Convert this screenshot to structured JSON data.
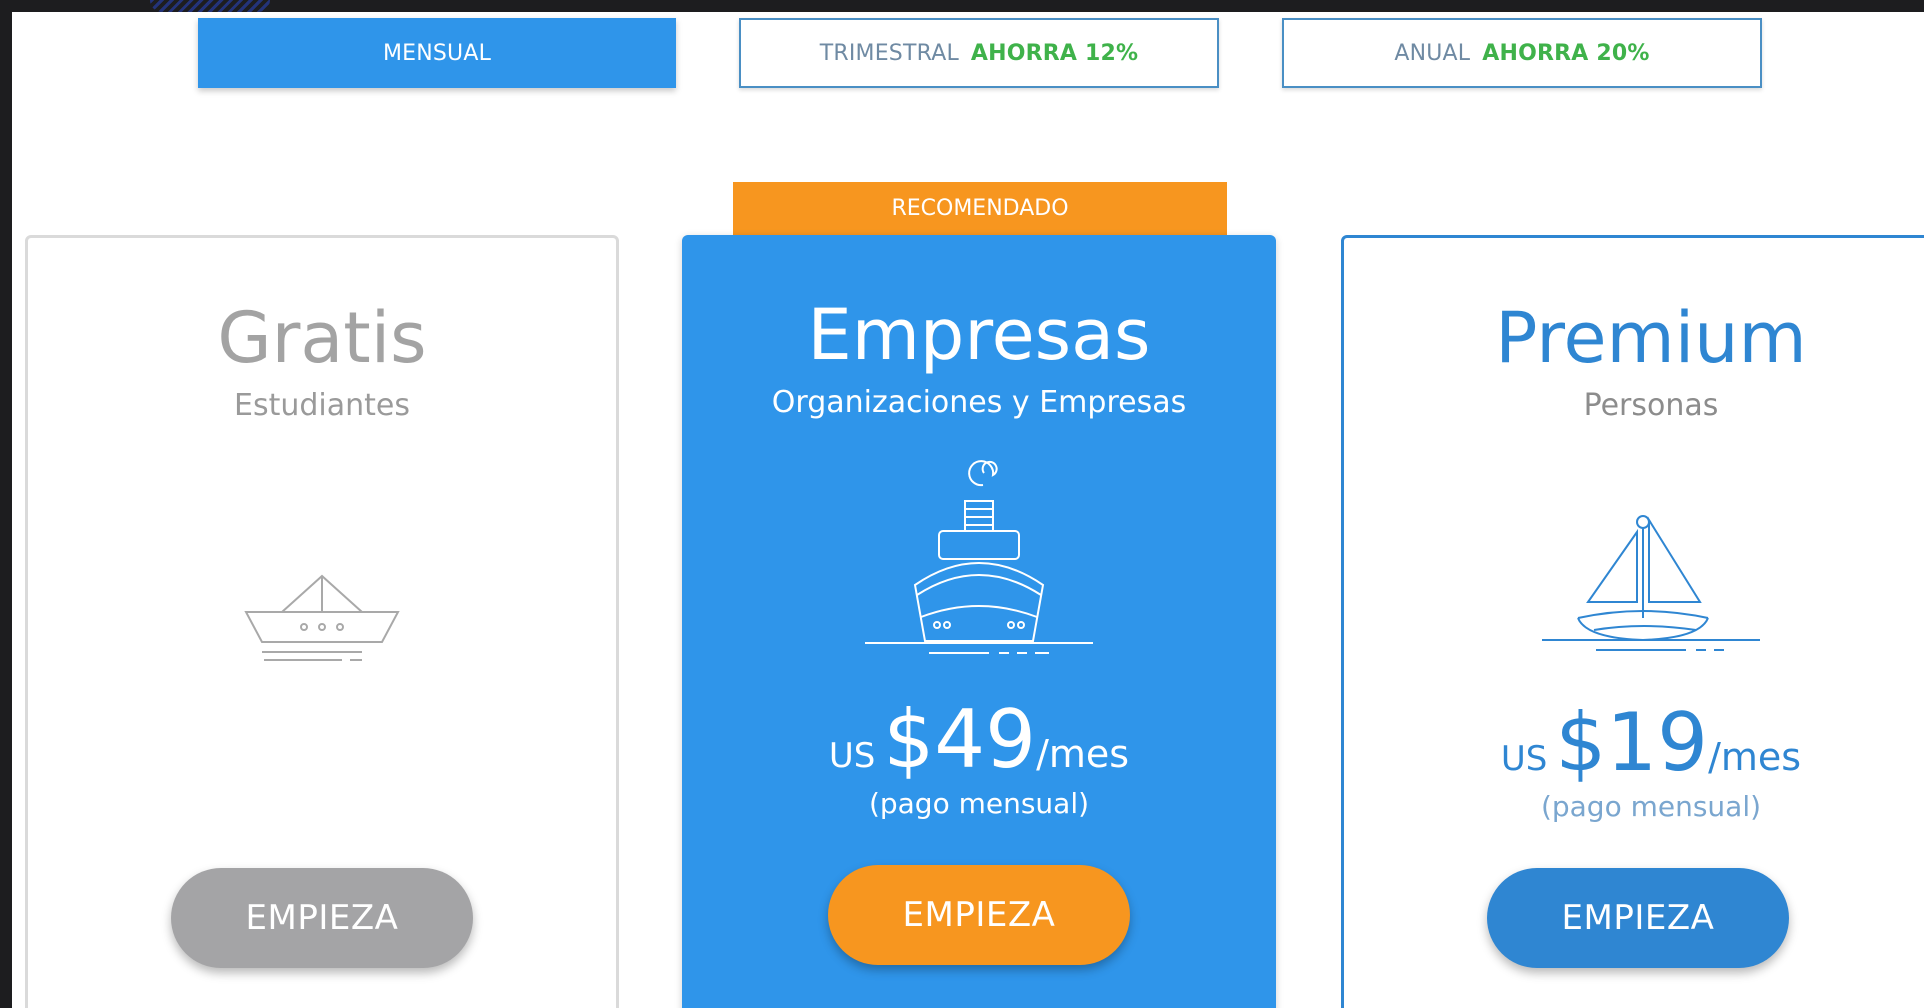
{
  "billing_tabs": [
    {
      "label": "MENSUAL",
      "savings": "",
      "active": true
    },
    {
      "label": "TRIMESTRAL",
      "savings": "AHORRA 12%",
      "active": false
    },
    {
      "label": "ANUAL",
      "savings": "AHORRA 20%",
      "active": false
    }
  ],
  "plans": [
    {
      "name": "Gratis",
      "audience": "Estudiantes",
      "icon": "paper-boat-icon",
      "currency": "",
      "price": "",
      "period": "",
      "billing_note": "",
      "cta_label": "EMPIEZA"
    },
    {
      "name": "Empresas",
      "audience": "Organizaciones y Empresas",
      "icon": "ship-icon",
      "badge": "RECOMENDADO",
      "currency": "US",
      "price": "$49",
      "period": "/mes",
      "billing_note": "(pago mensual)",
      "cta_label": "EMPIEZA"
    },
    {
      "name": "Premium",
      "audience": "Personas",
      "icon": "sailboat-icon",
      "currency": "US",
      "price": "$19",
      "period": "/mes",
      "billing_note": "(pago mensual)",
      "cta_label": "EMPIEZA"
    }
  ],
  "colors": {
    "primary": "#2f95ea",
    "accent": "#f7961f",
    "savings": "#3fb24a",
    "muted": "#a4a4a6"
  }
}
